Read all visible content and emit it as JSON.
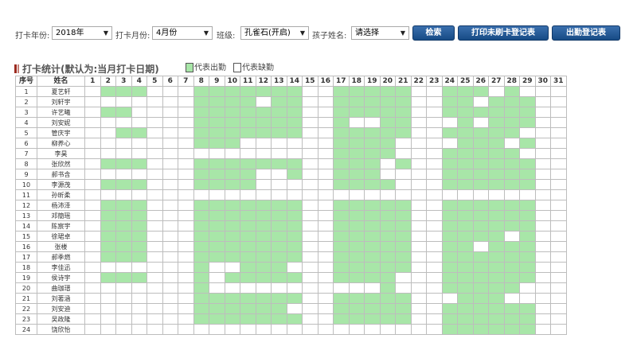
{
  "filters": {
    "year_label": "打卡年份:",
    "year_value": "2018年",
    "month_label": "打卡月份:",
    "month_value": "4月份",
    "class_label": "班级:",
    "class_value": "孔雀石(开启)",
    "child_label": "孩子姓名:",
    "child_value": "请选择"
  },
  "buttons": {
    "search": "检索",
    "print_unchecked": "打印未刷卡登记表",
    "attendance_sheet": "出勤登记表"
  },
  "section": {
    "title": "打卡统计(默认为:当月打卡日期)"
  },
  "legend": {
    "present": "代表出勤",
    "absent": "代表缺勤"
  },
  "colors": {
    "present": "#a8e6a8",
    "absent": "#ffffff",
    "button": "#1f5596"
  },
  "table": {
    "header_index": "序号",
    "header_name": "姓名",
    "days": [
      "1",
      "2",
      "3",
      "4",
      "5",
      "6",
      "7",
      "8",
      "9",
      "10",
      "11",
      "12",
      "13",
      "14",
      "15",
      "16",
      "17",
      "18",
      "19",
      "20",
      "21",
      "22",
      "23",
      "24",
      "25",
      "26",
      "27",
      "28",
      "29",
      "30",
      "31"
    ],
    "rows": [
      {
        "index": "1",
        "name": "夏艺轩",
        "att": "0111000111111100111110011101000"
      },
      {
        "index": "2",
        "name": "刘轩宇",
        "att": "0000000111101100111110011011100"
      },
      {
        "index": "3",
        "name": "许艺曦",
        "att": "0110000111111100111110011111100"
      },
      {
        "index": "4",
        "name": "刘安妮",
        "att": "0000000111111100100110001011100"
      },
      {
        "index": "5",
        "name": "管庆宇",
        "att": "0011000111111100111110011111000"
      },
      {
        "index": "6",
        "name": "柳养心",
        "att": "0000000111000000111100001110100"
      },
      {
        "index": "7",
        "name": "李昊",
        "att": "0000000000000000111100011111000"
      },
      {
        "index": "8",
        "name": "张欣然",
        "att": "0111000111111100111010011111100"
      },
      {
        "index": "9",
        "name": "郝书含",
        "att": "0000000111100100111000011111100"
      },
      {
        "index": "10",
        "name": "李源茂",
        "att": "0111000111100000111100011111100"
      },
      {
        "index": "11",
        "name": "孙昕柔",
        "att": "0000000000000000000000000000000"
      },
      {
        "index": "12",
        "name": "杨沛泽",
        "att": "0111000111111100111110011111100"
      },
      {
        "index": "13",
        "name": "邓簡瑶",
        "att": "0111000111111100111110011111100"
      },
      {
        "index": "14",
        "name": "陈宸宇",
        "att": "0111000111111100111110011111100"
      },
      {
        "index": "15",
        "name": "徐珺卓",
        "att": "0111000111111100111110011110100"
      },
      {
        "index": "16",
        "name": "张楼",
        "att": "0111000111111100111110011011100"
      },
      {
        "index": "17",
        "name": "郝季燃",
        "att": "0111000111111100111110011111100"
      },
      {
        "index": "18",
        "name": "李佳迅",
        "att": "0000000100111000111110011111100"
      },
      {
        "index": "19",
        "name": "侯诗宇",
        "att": "0111000101111100111100011111100"
      },
      {
        "index": "20",
        "name": "曲珈瑨",
        "att": "0000000100000000000100011111000"
      },
      {
        "index": "21",
        "name": "刘著涵",
        "att": "0000000111111100111110001110000"
      },
      {
        "index": "22",
        "name": "刘安迪",
        "att": "0000000111111000111110011111100"
      },
      {
        "index": "23",
        "name": "吴政隆",
        "att": "0000000111111100111110011111100"
      },
      {
        "index": "24",
        "name": "饶欣怡",
        "att": "0000000000000000000000011111100"
      }
    ]
  }
}
